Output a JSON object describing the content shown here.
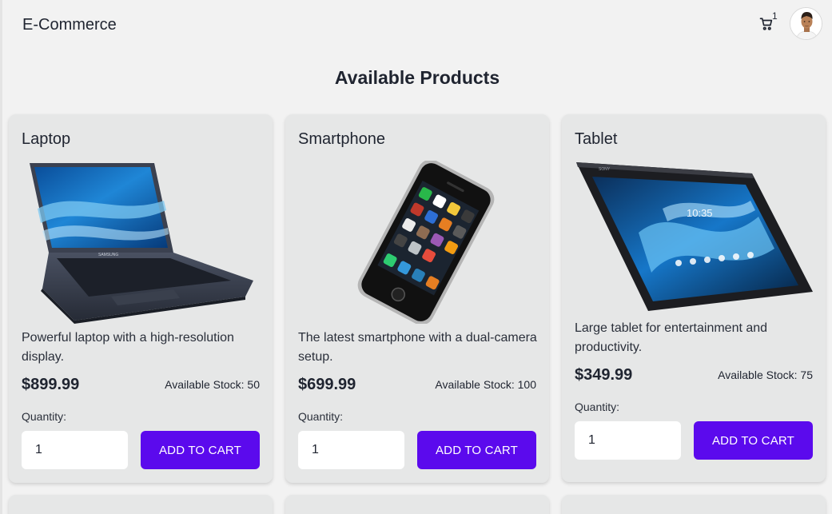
{
  "header": {
    "brand": "E-Commerce",
    "cart_count": "1",
    "cart_icon": "cart-icon",
    "avatar_icon": "user-avatar"
  },
  "page": {
    "title": "Available Products"
  },
  "colors": {
    "accent": "#5b0aed",
    "card_bg": "#e6e7e7",
    "page_bg": "#f2f2f2"
  },
  "products": [
    {
      "name": "Laptop",
      "image": "laptop-image",
      "description": "Powerful laptop with a high-resolution display.",
      "price": "$899.99",
      "stock": "Available Stock: 50",
      "quantity_label": "Quantity:",
      "quantity_value": "1",
      "button_label": "ADD TO CART"
    },
    {
      "name": "Smartphone",
      "image": "smartphone-image",
      "description": "The latest smartphone with a dual-camera setup.",
      "price": "$699.99",
      "stock": "Available Stock: 100",
      "quantity_label": "Quantity:",
      "quantity_value": "1",
      "button_label": "ADD TO CART"
    },
    {
      "name": "Tablet",
      "image": "tablet-image",
      "description": "Large tablet for entertainment and productivity.",
      "price": "$349.99",
      "stock": "Available Stock: 75",
      "quantity_label": "Quantity:",
      "quantity_value": "1",
      "button_label": "ADD TO CART"
    }
  ]
}
